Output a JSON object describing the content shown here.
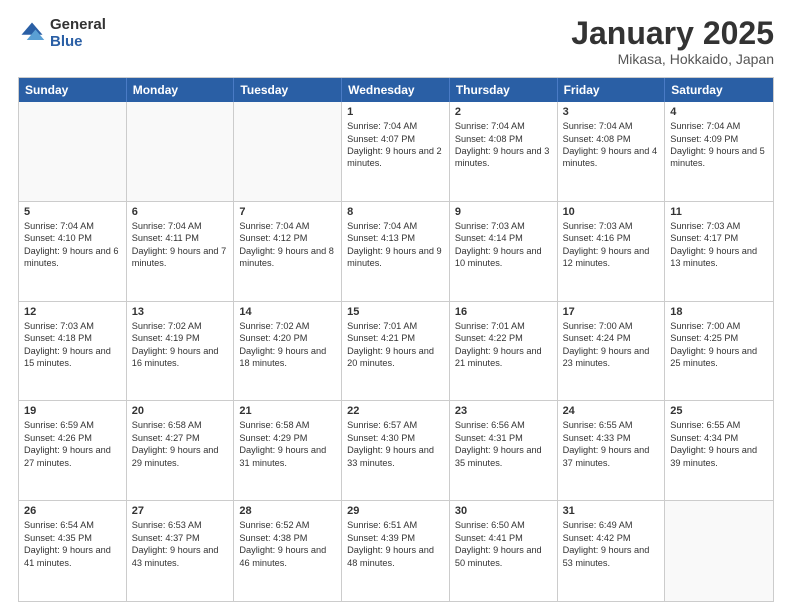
{
  "header": {
    "logo_line1": "General",
    "logo_line2": "Blue",
    "month": "January 2025",
    "location": "Mikasa, Hokkaido, Japan"
  },
  "weekdays": [
    "Sunday",
    "Monday",
    "Tuesday",
    "Wednesday",
    "Thursday",
    "Friday",
    "Saturday"
  ],
  "rows": [
    [
      {
        "day": "",
        "text": ""
      },
      {
        "day": "",
        "text": ""
      },
      {
        "day": "",
        "text": ""
      },
      {
        "day": "1",
        "text": "Sunrise: 7:04 AM\nSunset: 4:07 PM\nDaylight: 9 hours and 2 minutes."
      },
      {
        "day": "2",
        "text": "Sunrise: 7:04 AM\nSunset: 4:08 PM\nDaylight: 9 hours and 3 minutes."
      },
      {
        "day": "3",
        "text": "Sunrise: 7:04 AM\nSunset: 4:08 PM\nDaylight: 9 hours and 4 minutes."
      },
      {
        "day": "4",
        "text": "Sunrise: 7:04 AM\nSunset: 4:09 PM\nDaylight: 9 hours and 5 minutes."
      }
    ],
    [
      {
        "day": "5",
        "text": "Sunrise: 7:04 AM\nSunset: 4:10 PM\nDaylight: 9 hours and 6 minutes."
      },
      {
        "day": "6",
        "text": "Sunrise: 7:04 AM\nSunset: 4:11 PM\nDaylight: 9 hours and 7 minutes."
      },
      {
        "day": "7",
        "text": "Sunrise: 7:04 AM\nSunset: 4:12 PM\nDaylight: 9 hours and 8 minutes."
      },
      {
        "day": "8",
        "text": "Sunrise: 7:04 AM\nSunset: 4:13 PM\nDaylight: 9 hours and 9 minutes."
      },
      {
        "day": "9",
        "text": "Sunrise: 7:03 AM\nSunset: 4:14 PM\nDaylight: 9 hours and 10 minutes."
      },
      {
        "day": "10",
        "text": "Sunrise: 7:03 AM\nSunset: 4:16 PM\nDaylight: 9 hours and 12 minutes."
      },
      {
        "day": "11",
        "text": "Sunrise: 7:03 AM\nSunset: 4:17 PM\nDaylight: 9 hours and 13 minutes."
      }
    ],
    [
      {
        "day": "12",
        "text": "Sunrise: 7:03 AM\nSunset: 4:18 PM\nDaylight: 9 hours and 15 minutes."
      },
      {
        "day": "13",
        "text": "Sunrise: 7:02 AM\nSunset: 4:19 PM\nDaylight: 9 hours and 16 minutes."
      },
      {
        "day": "14",
        "text": "Sunrise: 7:02 AM\nSunset: 4:20 PM\nDaylight: 9 hours and 18 minutes."
      },
      {
        "day": "15",
        "text": "Sunrise: 7:01 AM\nSunset: 4:21 PM\nDaylight: 9 hours and 20 minutes."
      },
      {
        "day": "16",
        "text": "Sunrise: 7:01 AM\nSunset: 4:22 PM\nDaylight: 9 hours and 21 minutes."
      },
      {
        "day": "17",
        "text": "Sunrise: 7:00 AM\nSunset: 4:24 PM\nDaylight: 9 hours and 23 minutes."
      },
      {
        "day": "18",
        "text": "Sunrise: 7:00 AM\nSunset: 4:25 PM\nDaylight: 9 hours and 25 minutes."
      }
    ],
    [
      {
        "day": "19",
        "text": "Sunrise: 6:59 AM\nSunset: 4:26 PM\nDaylight: 9 hours and 27 minutes."
      },
      {
        "day": "20",
        "text": "Sunrise: 6:58 AM\nSunset: 4:27 PM\nDaylight: 9 hours and 29 minutes."
      },
      {
        "day": "21",
        "text": "Sunrise: 6:58 AM\nSunset: 4:29 PM\nDaylight: 9 hours and 31 minutes."
      },
      {
        "day": "22",
        "text": "Sunrise: 6:57 AM\nSunset: 4:30 PM\nDaylight: 9 hours and 33 minutes."
      },
      {
        "day": "23",
        "text": "Sunrise: 6:56 AM\nSunset: 4:31 PM\nDaylight: 9 hours and 35 minutes."
      },
      {
        "day": "24",
        "text": "Sunrise: 6:55 AM\nSunset: 4:33 PM\nDaylight: 9 hours and 37 minutes."
      },
      {
        "day": "25",
        "text": "Sunrise: 6:55 AM\nSunset: 4:34 PM\nDaylight: 9 hours and 39 minutes."
      }
    ],
    [
      {
        "day": "26",
        "text": "Sunrise: 6:54 AM\nSunset: 4:35 PM\nDaylight: 9 hours and 41 minutes."
      },
      {
        "day": "27",
        "text": "Sunrise: 6:53 AM\nSunset: 4:37 PM\nDaylight: 9 hours and 43 minutes."
      },
      {
        "day": "28",
        "text": "Sunrise: 6:52 AM\nSunset: 4:38 PM\nDaylight: 9 hours and 46 minutes."
      },
      {
        "day": "29",
        "text": "Sunrise: 6:51 AM\nSunset: 4:39 PM\nDaylight: 9 hours and 48 minutes."
      },
      {
        "day": "30",
        "text": "Sunrise: 6:50 AM\nSunset: 4:41 PM\nDaylight: 9 hours and 50 minutes."
      },
      {
        "day": "31",
        "text": "Sunrise: 6:49 AM\nSunset: 4:42 PM\nDaylight: 9 hours and 53 minutes."
      },
      {
        "day": "",
        "text": ""
      }
    ]
  ]
}
